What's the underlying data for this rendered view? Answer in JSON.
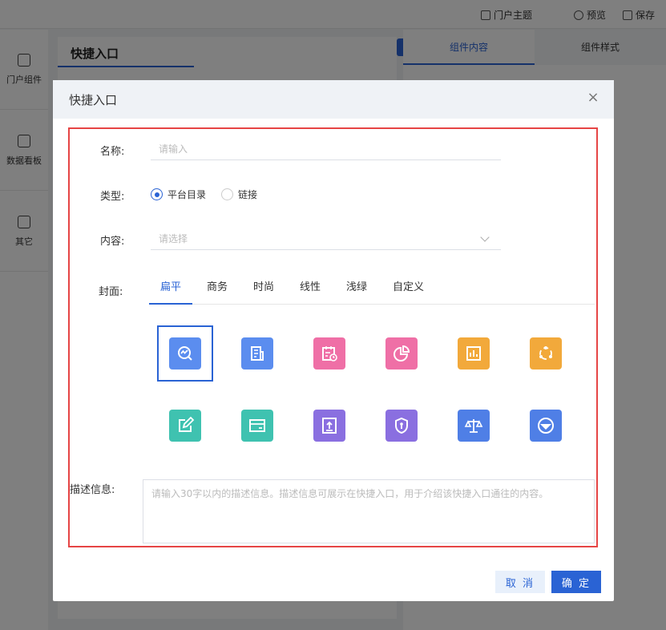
{
  "topbar": {
    "theme": "门户主题",
    "preview": "预览",
    "save": "保存"
  },
  "sidebar": {
    "items": [
      "门户组件",
      "数据看板",
      "其它"
    ]
  },
  "canvas": {
    "title": "快捷入口"
  },
  "right_panel": {
    "tabs": [
      "组件内容",
      "组件样式"
    ]
  },
  "modal": {
    "title": "快捷入口",
    "close": "×",
    "name_label": "名称:",
    "name_placeholder": "请输入",
    "type_label": "类型:",
    "type_options": [
      "平台目录",
      "链接"
    ],
    "type_selected": "平台目录",
    "content_label": "内容:",
    "content_placeholder": "请选择",
    "cover_label": "封面:",
    "cover_tabs": [
      "扁平",
      "商务",
      "时尚",
      "线性",
      "浅绿",
      "自定义"
    ],
    "cover_active_tab": "扁平",
    "desc_label": "描述信息:",
    "desc_placeholder": "请输入30字以内的描述信息。描述信息可展示在快捷入口，用于介绍该快捷入口通往的内容。",
    "cancel": "取 消",
    "confirm": "确 定"
  },
  "covers": [
    {
      "icon": "chart-search-icon",
      "color": "#5b8def"
    },
    {
      "icon": "document-icon",
      "color": "#5b8def"
    },
    {
      "icon": "calendar-clock-icon",
      "color": "#ef6fa6"
    },
    {
      "icon": "pie-chart-icon",
      "color": "#ef6fa6"
    },
    {
      "icon": "bar-chart-icon",
      "color": "#f2a93b"
    },
    {
      "icon": "network-icon",
      "color": "#f2a93b"
    },
    {
      "icon": "edit-icon",
      "color": "#3fc2b0"
    },
    {
      "icon": "card-icon",
      "color": "#3fc2b0"
    },
    {
      "icon": "upload-icon",
      "color": "#8a6fe0"
    },
    {
      "icon": "shield-icon",
      "color": "#8a6fe0"
    },
    {
      "icon": "balance-icon",
      "color": "#4f7fe6"
    },
    {
      "icon": "steering-icon",
      "color": "#4f7fe6"
    }
  ]
}
